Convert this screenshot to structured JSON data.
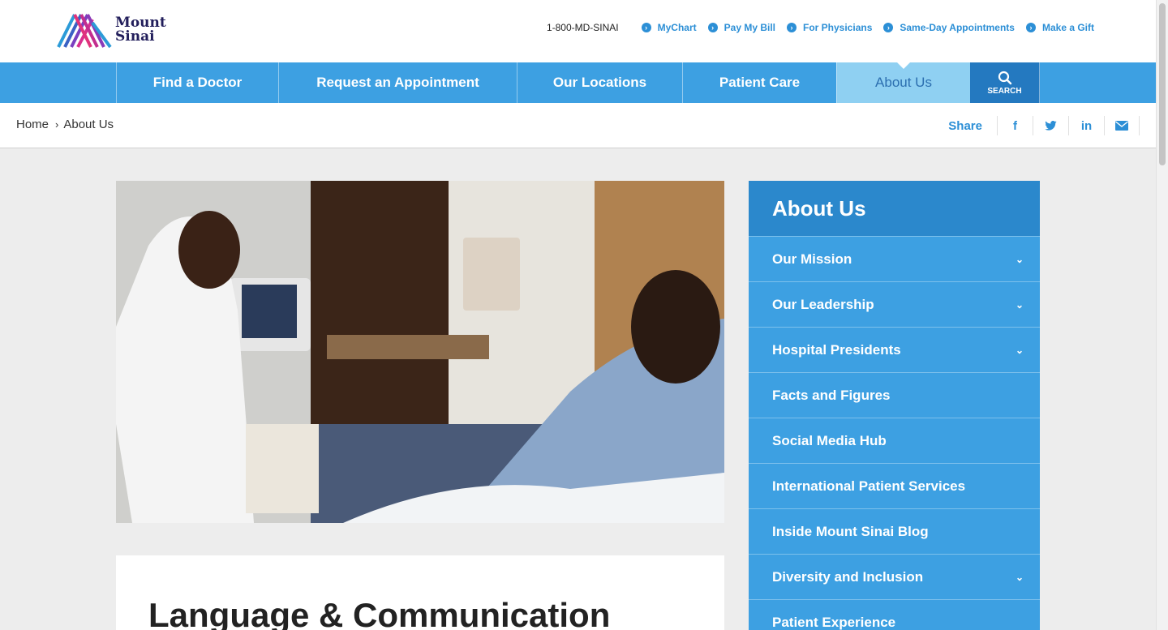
{
  "logo": {
    "line1": "Mount",
    "line2": "Sinai"
  },
  "utility": {
    "phone": "1-800-MD-SINAI",
    "links": [
      "MyChart",
      "Pay My Bill",
      "For Physicians",
      "Same-Day Appointments",
      "Make a Gift"
    ]
  },
  "nav": {
    "items": [
      "Find a Doctor",
      "Request an Appointment",
      "Our Locations",
      "Patient Care",
      "About Us"
    ],
    "active": "About Us",
    "search_label": "SEARCH"
  },
  "breadcrumb": {
    "home": "Home",
    "current": "About Us"
  },
  "share": {
    "label": "Share",
    "icons": [
      "facebook-icon",
      "twitter-icon",
      "linkedin-icon",
      "email-icon"
    ],
    "glyphs": {
      "facebook": "f",
      "linkedin": "in"
    }
  },
  "content": {
    "title": "Language & Communication"
  },
  "sidebar": {
    "title": "About Us",
    "items": [
      {
        "label": "Our Mission",
        "expandable": true
      },
      {
        "label": "Our Leadership",
        "expandable": true
      },
      {
        "label": "Hospital Presidents",
        "expandable": true
      },
      {
        "label": "Facts and Figures",
        "expandable": false
      },
      {
        "label": "Social Media Hub",
        "expandable": false
      },
      {
        "label": "International Patient Services",
        "expandable": false
      },
      {
        "label": "Inside Mount Sinai Blog",
        "expandable": false
      },
      {
        "label": "Diversity and Inclusion",
        "expandable": true
      },
      {
        "label": "Patient Experience",
        "expandable": false
      }
    ]
  },
  "colors": {
    "nav_blue": "#3da0e2",
    "nav_active": "#8fd0f2",
    "search_bg": "#2479c0",
    "sidebar_title_bg": "#2b88cc",
    "link_blue": "#2c8fd6"
  }
}
